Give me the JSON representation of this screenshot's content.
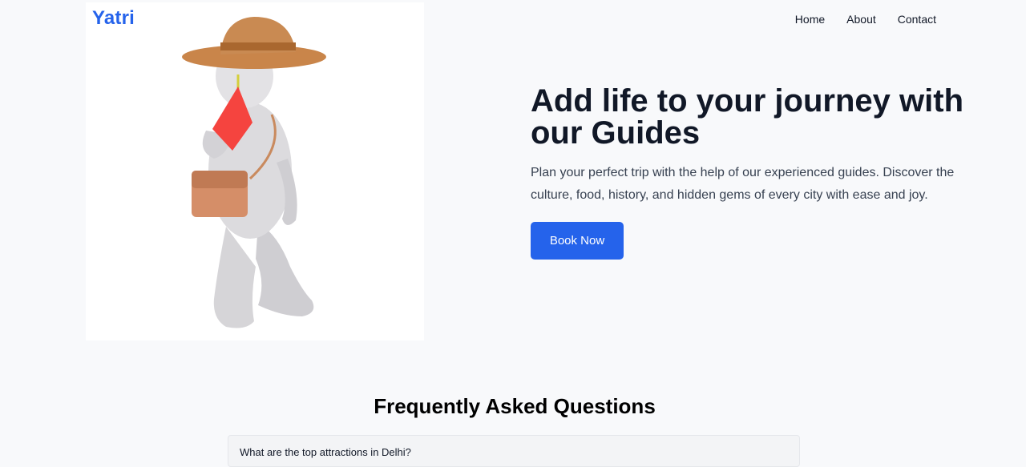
{
  "brand": {
    "logo_text": "Yatri",
    "accent_color": "#2563eb"
  },
  "nav": {
    "items": [
      {
        "label": "Home"
      },
      {
        "label": "About"
      },
      {
        "label": "Contact"
      }
    ]
  },
  "hero": {
    "image_description": "white 3D figure wearing a straw hat, holding a red flag, carrying a brown shoulder bag",
    "title": "Add life to your journey with our Guides",
    "subtitle": "Plan your perfect trip with the help of our experienced guides. Discover the culture, food, history, and hidden gems of every city with ease and joy.",
    "cta_label": "Book Now"
  },
  "faq": {
    "title": "Frequently Asked Questions",
    "items": [
      {
        "question": "What are the top attractions in Delhi?"
      }
    ]
  }
}
